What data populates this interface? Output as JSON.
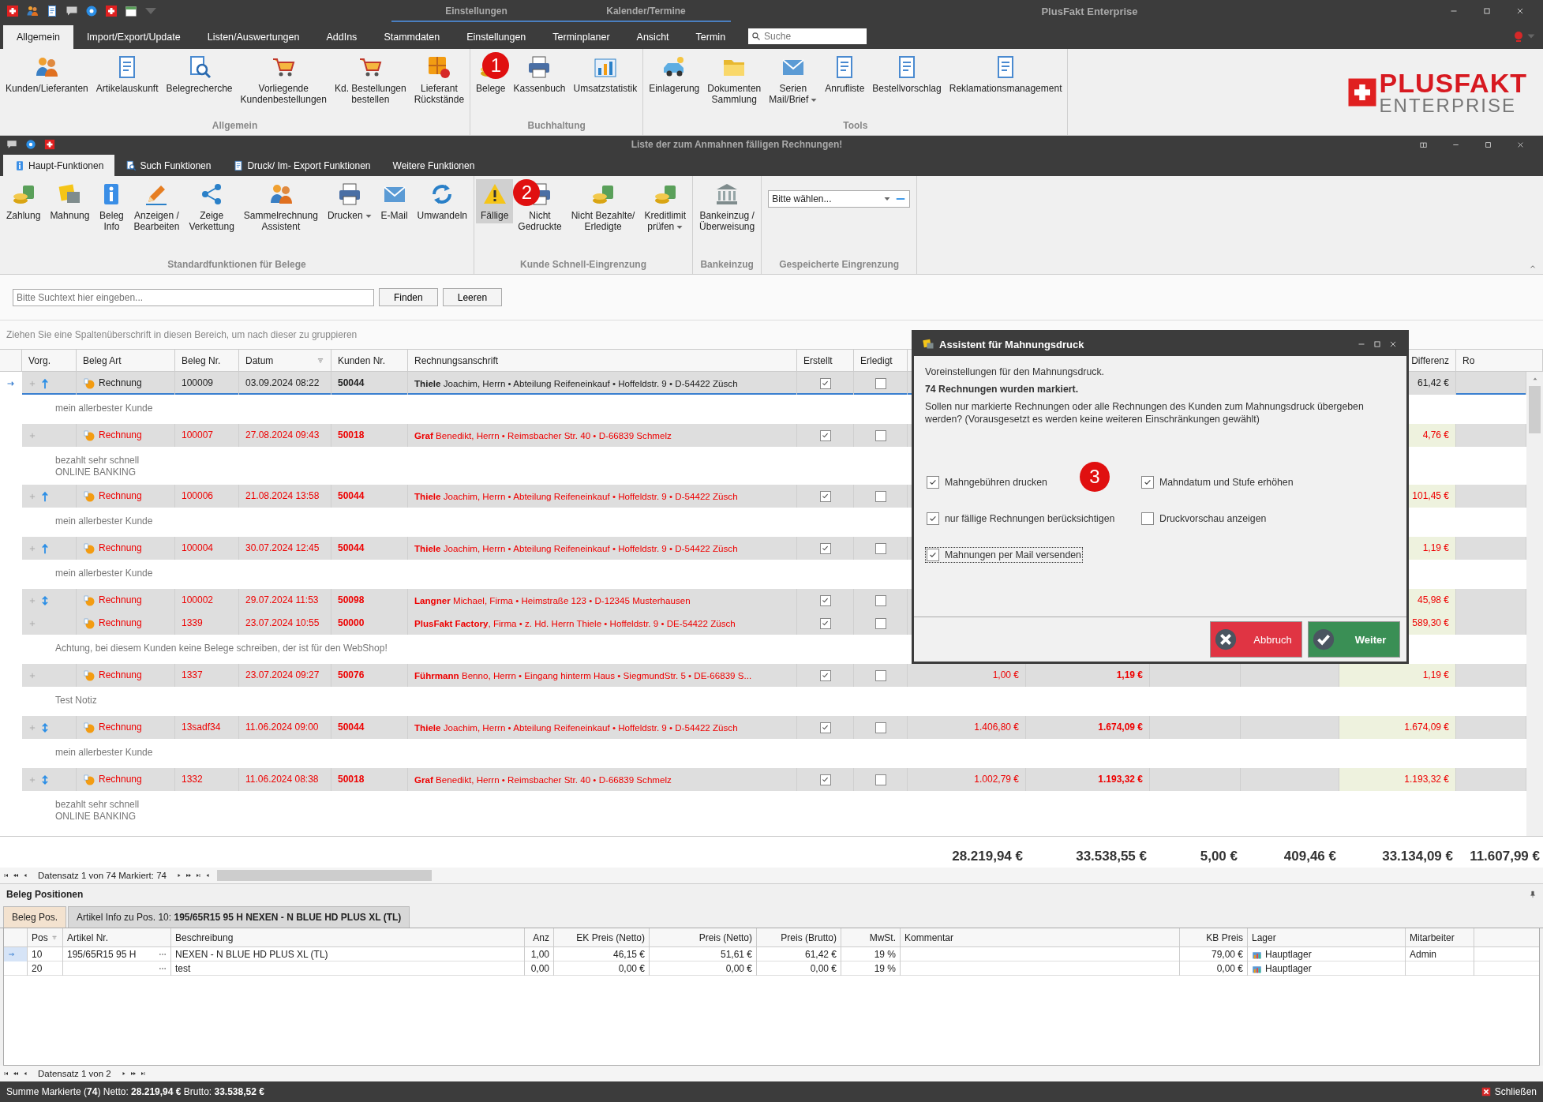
{
  "app_bar": {
    "context_tabs": [
      "Einstellungen",
      "Kalender/Termine"
    ],
    "title": "PlusFakt Enterprise"
  },
  "ribbon": {
    "tabs": [
      {
        "label": "Allgemein",
        "selected": true
      },
      {
        "label": "Import/Export/Update",
        "selected": false
      },
      {
        "label": "Listen/Auswertungen",
        "selected": false
      },
      {
        "label": "AddIns",
        "selected": false
      },
      {
        "label": "Stammdaten",
        "selected": false
      },
      {
        "label": "Einstellungen",
        "selected": false
      },
      {
        "label": "Terminplaner",
        "selected": false
      },
      {
        "label": "Ansicht",
        "selected": false
      },
      {
        "label": "Termin",
        "selected": false
      }
    ],
    "search": {
      "placeholder": "Suche"
    },
    "groups": [
      {
        "label": "Allgemein",
        "buttons": [
          {
            "label": "Kunden/Lieferanten"
          },
          {
            "label": "Artikelauskunft"
          },
          {
            "label": "Belegrecherche"
          },
          {
            "label": "Vorliegende\nKundenbestellungen"
          },
          {
            "label": "Kd. Bestellungen\nbestellen"
          },
          {
            "label": "Lieferant\nRückstände"
          }
        ]
      },
      {
        "label": "Buchhaltung",
        "buttons": [
          {
            "label": "Belege"
          },
          {
            "label": "Kassenbuch"
          },
          {
            "label": "Umsatzstatistik"
          }
        ]
      },
      {
        "label": "Tools",
        "buttons": [
          {
            "label": "Einlagerung"
          },
          {
            "label": "Dokumenten\nSammlung"
          },
          {
            "label": "Serien\nMail/Brief",
            "dropdown": true
          },
          {
            "label": "Anrufliste"
          },
          {
            "label": "Bestellvorschlag"
          },
          {
            "label": "Reklamationsmanagement"
          }
        ]
      }
    ],
    "logo": {
      "line1": "PLUSFAKT",
      "line2": "ENTERPRISE"
    }
  },
  "window": {
    "title": "Liste der zum Anmahnen fälligen Rechnungen!",
    "tabs": [
      {
        "label": "Haupt-Funktionen",
        "selected": true
      },
      {
        "label": "Such Funktionen",
        "selected": false
      },
      {
        "label": "Druck/ Im- Export Funktionen",
        "selected": false
      },
      {
        "label": "Weitere Funktionen",
        "selected": false
      }
    ],
    "groups": [
      {
        "label": "Standardfunktionen für Belege",
        "buttons": [
          {
            "label": "Zahlung",
            "selected": false
          },
          {
            "label": "Mahnung",
            "selected": false
          },
          {
            "label": "Beleg\nInfo",
            "selected": false
          },
          {
            "label": "Anzeigen /\nBearbeiten",
            "selected": false
          },
          {
            "label": "Zeige\nVerkettung",
            "selected": false
          },
          {
            "label": "Sammelrechnung\nAssistent",
            "selected": false
          },
          {
            "label": "Drucken",
            "dropdown": true,
            "selected": false
          },
          {
            "label": "E-Mail",
            "selected": false
          },
          {
            "label": "Umwandeln",
            "selected": false
          }
        ]
      },
      {
        "label": "Kunde Schnell-Eingrenzung",
        "buttons": [
          {
            "label": "Fällige",
            "selected": true
          },
          {
            "label": "Nicht\nGedruckte",
            "selected": false
          },
          {
            "label": "Nicht Bezahlte/\nErledigte",
            "selected": false
          },
          {
            "label": "Kreditlimit\nprüfen",
            "dropdown": true,
            "selected": false
          }
        ]
      },
      {
        "label": "Bankeinzug",
        "buttons": [
          {
            "label": "Bankeinzug /\nÜberweisung",
            "selected": false
          }
        ]
      },
      {
        "label": "Gespeicherte Eingrenzung",
        "combo": {
          "value": "Bitte wählen..."
        }
      }
    ]
  },
  "search": {
    "placeholder": "Bitte Suchtext hier eingeben...",
    "buttons": [
      "Finden",
      "Leeren"
    ]
  },
  "group_hint": "Ziehen Sie eine Spaltenüberschrift in diesen Bereich, um nach dieser zu gruppieren",
  "table": {
    "columns": [
      "Vorg.",
      "Beleg Art",
      "Beleg Nr.",
      "Datum",
      "Kunden Nr.",
      "Rechnungsanschrift",
      "Erstellt",
      "Erledigt"
    ],
    "columns_right": [
      "Differenz",
      "Ro"
    ],
    "rows": [
      {
        "selected": true,
        "overdue": false,
        "kind": "up",
        "type": "Rechnung",
        "number": "100009",
        "date": "03.09.2024 08:22",
        "customer": "50044",
        "address": "**Thiele** Joachim, Herrn • Abteilung Reifeneinkauf • Hoffeldstr. 9 • D-54422 Züsch",
        "created": true,
        "done": false,
        "difference": "61,42 €",
        "note": "mein allerbester Kunde"
      },
      {
        "selected": false,
        "overdue": true,
        "kind": "plain",
        "type": "Rechnung",
        "number": "100007",
        "date": "27.08.2024 09:43",
        "customer": "50018",
        "address": "**Graf** Benedikt, Herrn • Reimsbacher Str. 40 • D-66839 Schmelz",
        "created": true,
        "done": false,
        "difference": "4,76 €",
        "note": "bezahlt sehr schnell\nONLINE BANKING"
      },
      {
        "selected": false,
        "overdue": true,
        "kind": "up",
        "type": "Rechnung",
        "number": "100006",
        "date": "21.08.2024 13:58",
        "customer": "50044",
        "address": "**Thiele** Joachim, Herrn • Abteilung Reifeneinkauf • Hoffeldstr. 9 • D-54422 Züsch",
        "created": true,
        "done": false,
        "difference": "101,45 €",
        "note": "mein allerbester Kunde"
      },
      {
        "selected": false,
        "overdue": true,
        "kind": "up",
        "type": "Rechnung",
        "number": "100004",
        "date": "30.07.2024 12:45",
        "customer": "50044",
        "address": "**Thiele** Joachim, Herrn • Abteilung Reifeneinkauf • Hoffeldstr. 9 • D-54422 Züsch",
        "created": true,
        "done": false,
        "difference": "1,19 €",
        "note": "mein allerbester Kunde"
      },
      {
        "selected": false,
        "overdue": true,
        "kind": "both",
        "type": "Rechnung",
        "number": "100002",
        "date": "29.07.2024 11:53",
        "customer": "50098",
        "address": "**Langner** Michael, Firma • Heimstraße 123 • D-12345 Musterhausen",
        "created": true,
        "done": false,
        "difference": "45,98 €"
      },
      {
        "selected": false,
        "overdue": true,
        "kind": "plain",
        "type": "Rechnung",
        "number": "1339",
        "date": "23.07.2024 10:55",
        "customer": "50000",
        "address": "**PlusFakt Factory**, Firma • z. Hd. Herrn Thiele • Hoffeldstr. 9 • DE-54422 Züsch",
        "created": true,
        "done": false,
        "difference": "589,30 €",
        "note": "Achtung, bei diesem Kunden keine Belege schreiben, der ist für den WebShop!"
      },
      {
        "selected": false,
        "overdue": true,
        "kind": "plain",
        "type": "Rechnung",
        "number": "1337",
        "date": "23.07.2024 09:27",
        "customer": "50076",
        "address": "**Führmann** Benno, Herrn • Eingang hinterm Haus • SiegmundStr. 5 • DE-66839 S...",
        "created": true,
        "done": false,
        "net": "1,00 €",
        "gross": "1,19 €",
        "difference": "1,19 €",
        "note": "Test Notiz"
      },
      {
        "selected": false,
        "overdue": true,
        "kind": "both",
        "type": "Rechnung",
        "number": "13sadf34",
        "date": "11.06.2024 09:00",
        "customer": "50044",
        "address": "**Thiele** Joachim, Herrn • Abteilung Reifeneinkauf • Hoffeldstr. 9 • D-54422 Züsch",
        "created": true,
        "done": false,
        "net": "1.406,80 €",
        "gross": "1.674,09 €",
        "difference": "1.674,09 €",
        "note": "mein allerbester Kunde"
      },
      {
        "selected": false,
        "overdue": true,
        "kind": "both",
        "type": "Rechnung",
        "number": "1332",
        "date": "11.06.2024 08:38",
        "customer": "50018",
        "address": "**Graf** Benedikt, Herrn • Reimsbacher Str. 40 • D-66839 Schmelz",
        "created": true,
        "done": false,
        "net": "1.002,79 €",
        "gross": "1.193,32 €",
        "difference": "1.193,32 €",
        "note": "bezahlt sehr schnell\nONLINE BANKING"
      }
    ],
    "totals": [
      "28.219,94 €",
      "33.538,55 €",
      "5,00 €",
      "409,46 €",
      "33.134,09 €",
      "11.607,99 €"
    ],
    "navigator": "Datensatz 1 von 74 Markiert: 74"
  },
  "dialog": {
    "title": "Assistent für Mahnungsdruck",
    "intro": "Voreinstellungen für den Mahnungsdruck.",
    "marked": "74 Rechnungen wurden markiert.",
    "question": "Sollen nur markierte Rechnungen oder alle Rechnungen des Kunden zum Mahnungsdruck übergeben werden? (Vorausgesetzt es werden keine weiteren Einschränkungen gewählt)",
    "options": [
      {
        "label": "Mahngebühren drucken",
        "checked": true,
        "focused": false
      },
      {
        "label": "Mahndatum und Stufe erhöhen",
        "checked": true,
        "focused": false
      },
      {
        "label": "nur fällige Rechnungen berücksichtigen",
        "checked": true,
        "focused": false
      },
      {
        "label": "Druckvorschau anzeigen",
        "checked": false,
        "focused": false
      },
      {
        "label": "Mahnungen per Mail versenden",
        "checked": true,
        "focused": true
      }
    ],
    "buttons": [
      {
        "label": "Abbruch",
        "kind": "cancel"
      },
      {
        "label": "Weiter",
        "kind": "confirm"
      }
    ]
  },
  "callouts": [
    "1",
    "2",
    "3"
  ],
  "positions": {
    "title": "Beleg Positionen",
    "tabs": [
      {
        "label": "Beleg Pos.",
        "selected": true
      },
      {
        "label": "Artikel Info zu Pos. 10: **195/65R15 95 H NEXEN - N BLUE HD PLUS XL (TL)**",
        "selected": false
      }
    ],
    "columns": [
      "Pos",
      "Artikel Nr.",
      "Beschreibung",
      "Anz",
      "EK Preis (Netto)",
      "Preis (Netto)",
      "Preis (Brutto)",
      "MwSt.",
      "Kommentar",
      "KB Preis",
      "Lager",
      "Mitarbeiter"
    ],
    "rows": [
      {
        "selected": true,
        "cells": [
          "10",
          "195/65R15 95 H",
          "NEXEN - N BLUE HD PLUS XL (TL)",
          "1,00",
          "46,15 €",
          "51,61 €",
          "61,42 €",
          "19 %",
          "",
          "79,00 €",
          "Hauptlager",
          "Admin"
        ]
      },
      {
        "selected": false,
        "cells": [
          "20",
          "",
          "test",
          "0,00",
          "0,00 €",
          "0,00 €",
          "0,00 €",
          "19 %",
          "",
          "0,00 €",
          "Hauptlager",
          ""
        ]
      }
    ],
    "navigator": "Datensatz 1 von 2"
  },
  "status_bar": {
    "summary": "Summe Markierte (**74**) Netto: **28.219,94 €** Brutto: **33.538,52 €**",
    "close": "Schließen"
  }
}
